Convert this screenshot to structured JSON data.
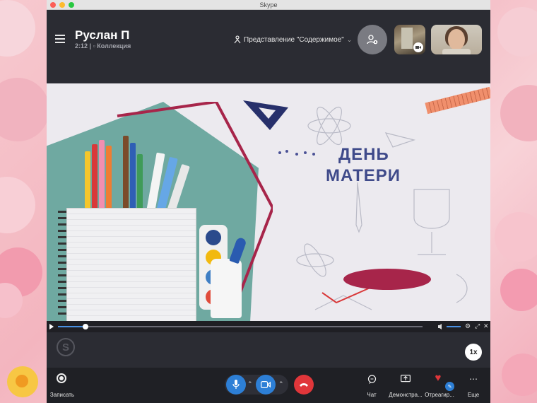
{
  "window": {
    "title": "Skype"
  },
  "call": {
    "caller_name": "Руслан П",
    "duration": "2:12",
    "separator": "|",
    "collection_label": "Коллекция",
    "view_mode": "Представление \"Содержимое\"",
    "view_mode_chevron": "⌄"
  },
  "slide": {
    "title_line1": "ДЕНЬ",
    "title_line2": "МАТЕРИ"
  },
  "player": {
    "speed": "1x"
  },
  "controls": {
    "record": "Записать",
    "chat": "Чат",
    "share": "Демонстра...",
    "react": "Отреагир...",
    "more": "Еще"
  },
  "colors": {
    "end_call": "#e0363a",
    "mic": "#2d7fd6",
    "accent": "#4a90e2",
    "slide_title": "#3f4a8a"
  }
}
